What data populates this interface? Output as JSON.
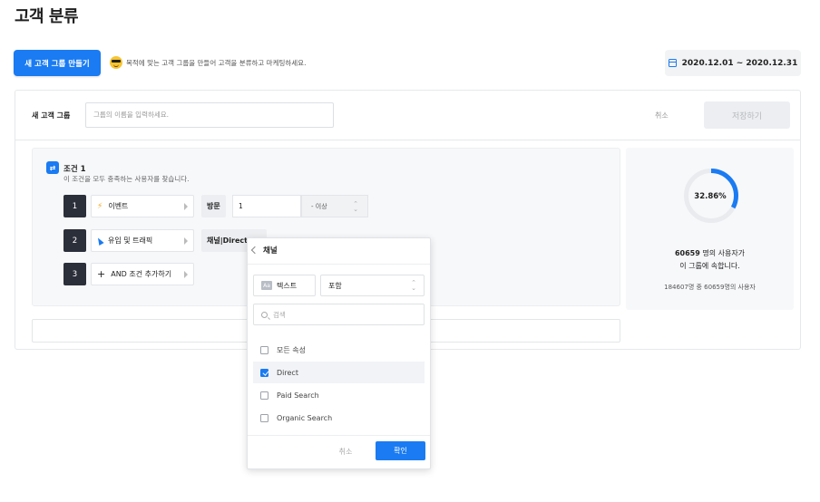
{
  "page": {
    "title": "고객 분류"
  },
  "toolbar": {
    "new_group_label": "새 고객 그룹 만들기",
    "hint": "목적에 맞는 고객 그룹을 만들어 고객을 분류하고 마케팅하세요.",
    "date_range": "2020.12.01 ~ 2020.12.31"
  },
  "group_name": {
    "label": "새 고객 그룹",
    "placeholder": "그룹의 이름을 입력하세요.",
    "cancel_label": "취소",
    "save_label": "저장하기"
  },
  "condition": {
    "icon": "⇄",
    "title": "조건 1",
    "description": "이 조건을 모두 충족하는 사용자를 찾습니다.",
    "rows": [
      {
        "number": "1",
        "selector": "이벤트",
        "chip": "방문",
        "value": "1",
        "comparator": "- 이상"
      },
      {
        "number": "2",
        "selector": "유입 및 트래픽",
        "chip": "채널|Direct"
      },
      {
        "number": "3",
        "selector": "AND 조건 추가하기"
      }
    ]
  },
  "stats": {
    "percent": "32.86%",
    "percent_value": 32.86,
    "highlight": "60659",
    "line1_suffix": " 명의 사용자가",
    "line2": "이 그룹에 속합니다.",
    "line3": "184607명 중 60659명의 사용자"
  },
  "channel_popup": {
    "title": "채널",
    "type_badge": "Aa",
    "type_label": "텍스트",
    "match_label": "포함",
    "search_placeholder": "검색",
    "options": [
      {
        "label": "모든 속성",
        "checked": false
      },
      {
        "label": "Direct",
        "checked": true
      },
      {
        "label": "Paid Search",
        "checked": false
      },
      {
        "label": "Organic Search",
        "checked": false
      }
    ],
    "cancel_label": "취소",
    "confirm_label": "확인"
  },
  "colors": {
    "accent": "#1a7bf2",
    "dark": "#2b2f3a"
  }
}
